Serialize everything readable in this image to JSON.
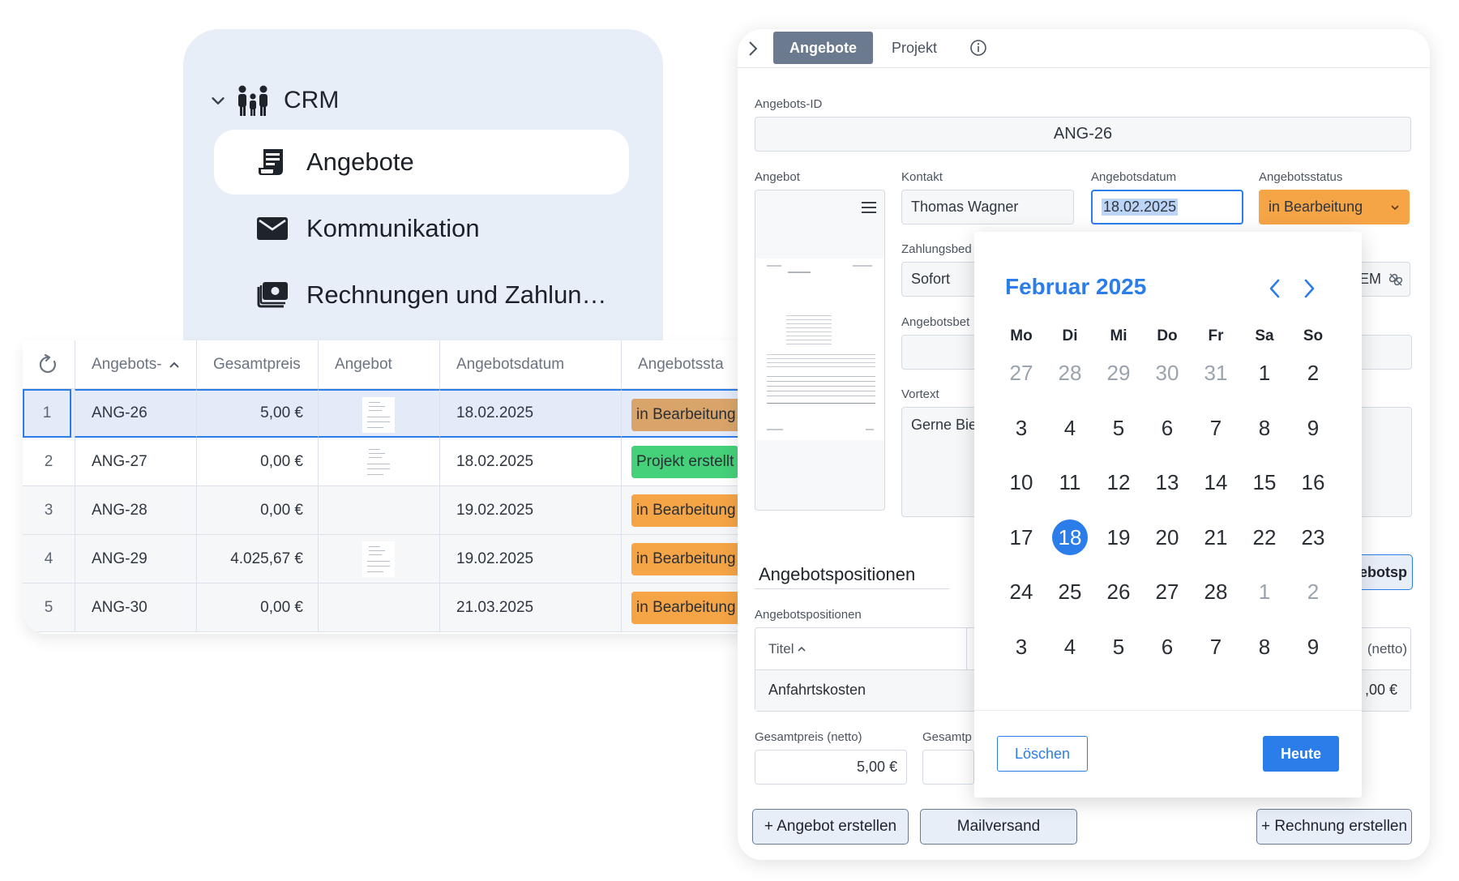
{
  "sidebar": {
    "section": "CRM",
    "items": [
      {
        "label": "Angebote",
        "icon": "receipt-icon"
      },
      {
        "label": "Kommunikation",
        "icon": "envelope-icon"
      },
      {
        "label": "Rechnungen und Zahlun…",
        "icon": "cash-icon"
      }
    ]
  },
  "table": {
    "columns": [
      "Angebots-",
      "Gesamtpreis",
      "Angebot",
      "Angebotsdatum",
      "Angebotssta"
    ],
    "rows": [
      {
        "num": "1",
        "id": "ANG-26",
        "price": "5,00 €",
        "date": "18.02.2025",
        "status": "in Bearbeitung"
      },
      {
        "num": "2",
        "id": "ANG-27",
        "price": "0,00 €",
        "date": "18.02.2025",
        "status": "Projekt erstellt"
      },
      {
        "num": "3",
        "id": "ANG-28",
        "price": "0,00 €",
        "date": "19.02.2025",
        "status": "in Bearbeitung"
      },
      {
        "num": "4",
        "id": "ANG-29",
        "price": "4.025,67 €",
        "date": "19.02.2025",
        "status": "in Bearbeitung"
      },
      {
        "num": "5",
        "id": "ANG-30",
        "price": "0,00 €",
        "date": "21.03.2025",
        "status": "in Bearbeitung"
      }
    ]
  },
  "panel": {
    "tabs": [
      "Angebote",
      "Projekt"
    ],
    "id_label": "Angebots-ID",
    "id_value": "ANG-26",
    "angebot_label": "Angebot",
    "kontakt_label": "Kontakt",
    "kontakt_value": "Thomas Wagner",
    "datum_label": "Angebotsdatum",
    "datum_value": "18.02.2025",
    "status_label": "Angebotsstatus",
    "status_value": "in Bearbeitung",
    "zahlung_label": "Zahlungsbed",
    "zahlung_value": "Sofort",
    "zahlung_tail": "EM",
    "angebotsbet_label": "Angebotsbet",
    "vortext_label": "Vortext",
    "vortext_value": "Gerne Bie",
    "positions_heading": "Angebotspositionen",
    "positions_button_tail": "ebotsp",
    "positions_label": "Angebotspositionen",
    "positions_col_title": "Titel",
    "positions_col_netto": "(netto)",
    "position_row_title": "Anfahrtskosten",
    "position_row_price": ",00 €",
    "gesamt_netto_label": "Gesamtpreis (netto)",
    "gesamt_netto_value": "5,00 €",
    "gesamt_brutto_label": "Gesamtp",
    "buttons": {
      "angebot": "+ Angebot erstellen",
      "mail": "Mailversand",
      "rechnung": "+ Rechnung erstellen"
    }
  },
  "datepicker": {
    "month": "Februar 2025",
    "weekdays": [
      "Mo",
      "Di",
      "Mi",
      "Do",
      "Fr",
      "Sa",
      "So"
    ],
    "weeks": [
      [
        "27",
        "28",
        "29",
        "30",
        "31",
        "1",
        "2"
      ],
      [
        "3",
        "4",
        "5",
        "6",
        "7",
        "8",
        "9"
      ],
      [
        "10",
        "11",
        "12",
        "13",
        "14",
        "15",
        "16"
      ],
      [
        "17",
        "18",
        "19",
        "20",
        "21",
        "22",
        "23"
      ],
      [
        "24",
        "25",
        "26",
        "27",
        "28",
        "1",
        "2"
      ],
      [
        "3",
        "4",
        "5",
        "6",
        "7",
        "8",
        "9"
      ]
    ],
    "selected": "18",
    "clear_label": "Löschen",
    "today_label": "Heute"
  },
  "colors": {
    "accent": "#2b7de9",
    "status_in_progress": "#f5a446",
    "status_in_progress_selected": "#d9a46a",
    "status_project": "#45d17a"
  }
}
